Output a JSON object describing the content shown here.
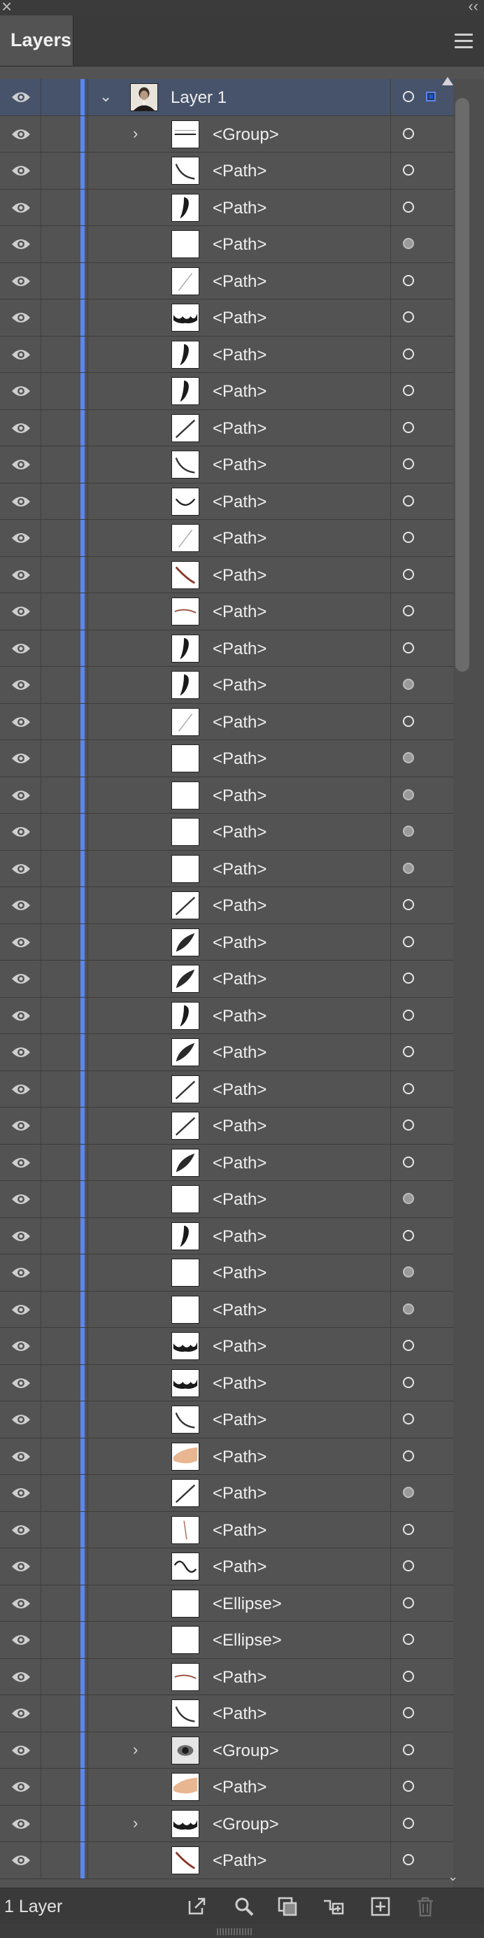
{
  "window": {
    "close_icon": "close-icon",
    "collapse_label": "‹‹"
  },
  "panel": {
    "tab_title": "Layers",
    "menu_icon": "hamburger-menu-icon"
  },
  "layer": {
    "name": "Layer 1",
    "thumbnail": "portrait"
  },
  "items": [
    {
      "name": "<Group>",
      "thumb": "line-h",
      "expandable": true,
      "filled": false
    },
    {
      "name": "<Path>",
      "thumb": "curve",
      "expandable": false,
      "filled": false
    },
    {
      "name": "<Path>",
      "thumb": "dark-stroke",
      "expandable": false,
      "filled": false
    },
    {
      "name": "<Path>",
      "thumb": "blank",
      "expandable": false,
      "filled": true
    },
    {
      "name": "<Path>",
      "thumb": "light-line",
      "expandable": false,
      "filled": false
    },
    {
      "name": "<Path>",
      "thumb": "dark-wave",
      "expandable": false,
      "filled": false
    },
    {
      "name": "<Path>",
      "thumb": "dark-stroke",
      "expandable": false,
      "filled": false
    },
    {
      "name": "<Path>",
      "thumb": "dark-stroke",
      "expandable": false,
      "filled": false
    },
    {
      "name": "<Path>",
      "thumb": "diagonal",
      "expandable": false,
      "filled": false
    },
    {
      "name": "<Path>",
      "thumb": "curve",
      "expandable": false,
      "filled": false
    },
    {
      "name": "<Path>",
      "thumb": "smile",
      "expandable": false,
      "filled": false
    },
    {
      "name": "<Path>",
      "thumb": "light-line",
      "expandable": false,
      "filled": false
    },
    {
      "name": "<Path>",
      "thumb": "red-diagonal",
      "expandable": false,
      "filled": false
    },
    {
      "name": "<Path>",
      "thumb": "red-curve",
      "expandable": false,
      "filled": false
    },
    {
      "name": "<Path>",
      "thumb": "dark-stroke",
      "expandable": false,
      "filled": false
    },
    {
      "name": "<Path>",
      "thumb": "dark-stroke",
      "expandable": false,
      "filled": true
    },
    {
      "name": "<Path>",
      "thumb": "light-line",
      "expandable": false,
      "filled": false
    },
    {
      "name": "<Path>",
      "thumb": "blank",
      "expandable": false,
      "filled": true
    },
    {
      "name": "<Path>",
      "thumb": "blank",
      "expandable": false,
      "filled": true
    },
    {
      "name": "<Path>",
      "thumb": "blank",
      "expandable": false,
      "filled": true
    },
    {
      "name": "<Path>",
      "thumb": "blank",
      "expandable": false,
      "filled": true
    },
    {
      "name": "<Path>",
      "thumb": "diagonal",
      "expandable": false,
      "filled": false
    },
    {
      "name": "<Path>",
      "thumb": "dark-leaf",
      "expandable": false,
      "filled": false
    },
    {
      "name": "<Path>",
      "thumb": "dark-leaf",
      "expandable": false,
      "filled": false
    },
    {
      "name": "<Path>",
      "thumb": "dark-stroke",
      "expandable": false,
      "filled": false
    },
    {
      "name": "<Path>",
      "thumb": "dark-leaf",
      "expandable": false,
      "filled": false
    },
    {
      "name": "<Path>",
      "thumb": "diagonal",
      "expandable": false,
      "filled": false
    },
    {
      "name": "<Path>",
      "thumb": "diagonal",
      "expandable": false,
      "filled": false
    },
    {
      "name": "<Path>",
      "thumb": "dark-leaf",
      "expandable": false,
      "filled": false
    },
    {
      "name": "<Path>",
      "thumb": "blank",
      "expandable": false,
      "filled": true
    },
    {
      "name": "<Path>",
      "thumb": "dark-stroke",
      "expandable": false,
      "filled": false
    },
    {
      "name": "<Path>",
      "thumb": "blank",
      "expandable": false,
      "filled": true
    },
    {
      "name": "<Path>",
      "thumb": "blank",
      "expandable": false,
      "filled": true
    },
    {
      "name": "<Path>",
      "thumb": "dark-wave",
      "expandable": false,
      "filled": false
    },
    {
      "name": "<Path>",
      "thumb": "dark-wave",
      "expandable": false,
      "filled": false
    },
    {
      "name": "<Path>",
      "thumb": "curve",
      "expandable": false,
      "filled": false
    },
    {
      "name": "<Path>",
      "thumb": "skin",
      "expandable": false,
      "filled": false
    },
    {
      "name": "<Path>",
      "thumb": "diagonal",
      "expandable": false,
      "filled": true
    },
    {
      "name": "<Path>",
      "thumb": "red-line",
      "expandable": false,
      "filled": false
    },
    {
      "name": "<Path>",
      "thumb": "s-curve",
      "expandable": false,
      "filled": false
    },
    {
      "name": "<Ellipse>",
      "thumb": "blank",
      "expandable": false,
      "filled": false
    },
    {
      "name": "<Ellipse>",
      "thumb": "blank",
      "expandable": false,
      "filled": false
    },
    {
      "name": "<Path>",
      "thumb": "red-curve",
      "expandable": false,
      "filled": false
    },
    {
      "name": "<Path>",
      "thumb": "curve",
      "expandable": false,
      "filled": false
    },
    {
      "name": "<Group>",
      "thumb": "eye",
      "expandable": true,
      "filled": false
    },
    {
      "name": "<Path>",
      "thumb": "skin",
      "expandable": false,
      "filled": false
    },
    {
      "name": "<Group>",
      "thumb": "dark-wave",
      "expandable": true,
      "filled": false
    },
    {
      "name": "<Path>",
      "thumb": "red-diagonal",
      "expandable": false,
      "filled": false
    }
  ],
  "footer": {
    "count_label": "1 Layer",
    "icons": [
      "export-icon",
      "locate-object-icon",
      "make-clipping-mask-icon",
      "create-sublayer-icon",
      "new-layer-icon",
      "delete-icon"
    ]
  },
  "colors": {
    "layer_color": "#5a86f0",
    "panel_bg": "#535353",
    "selected_row": "#46536a"
  }
}
